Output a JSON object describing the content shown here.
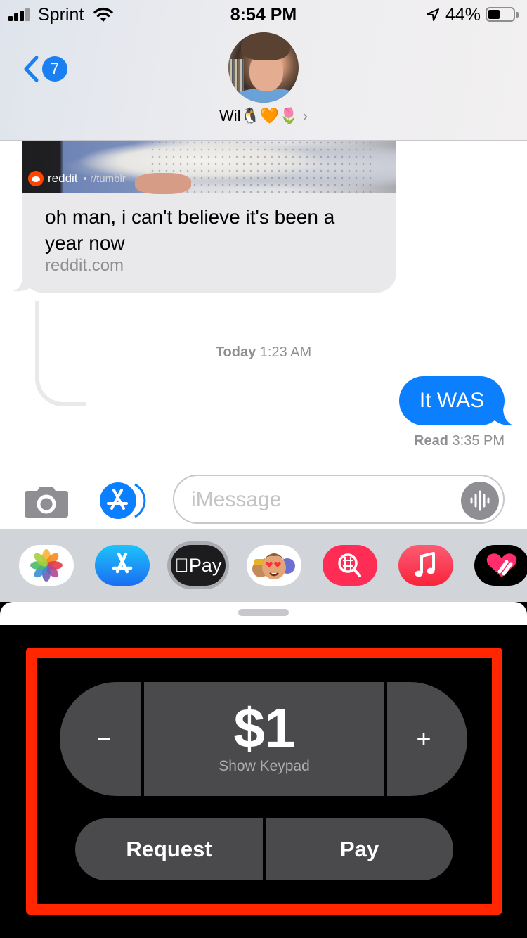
{
  "status_bar": {
    "carrier": "Sprint",
    "time": "8:54 PM",
    "battery_percent": "44%",
    "battery_level": 0.44
  },
  "header": {
    "back_badge_count": "7",
    "contact_name": "Wil",
    "contact_emoji": "🐧🧡🌷",
    "chevron": "›"
  },
  "conversation": {
    "link_preview": {
      "source": "reddit",
      "subreddit": "r/tumblr",
      "title": "oh man, i can't believe it's been a year now",
      "domain": "reddit.com"
    },
    "timestamp": {
      "day": "Today",
      "time": "1:23 AM"
    },
    "sent_message": "It WAS",
    "read_receipt": {
      "label": "Read",
      "time": "3:35 PM"
    }
  },
  "composer": {
    "placeholder": "iMessage",
    "value": ""
  },
  "app_drawer": {
    "apps": [
      {
        "name": "Photos",
        "icon": "photos-icon"
      },
      {
        "name": "App Store",
        "icon": "app-store-icon"
      },
      {
        "name": "Apple Pay",
        "icon": "apple-pay-icon",
        "label": "Pay",
        "selected": true
      },
      {
        "name": "Memoji Stickers",
        "icon": "memoji-icon"
      },
      {
        "name": "#images",
        "icon": "images-search-icon"
      },
      {
        "name": "Music",
        "icon": "music-icon"
      },
      {
        "name": "Digital Touch",
        "icon": "digital-touch-icon"
      }
    ]
  },
  "apple_pay": {
    "minus_label": "−",
    "plus_label": "+",
    "amount": "$1",
    "show_keypad_label": "Show Keypad",
    "request_label": "Request",
    "pay_label": "Pay"
  },
  "colors": {
    "imessage_blue": "#0b7ffe",
    "highlight_red": "#ff2600",
    "pay_button_gray": "#4a4a4c"
  }
}
